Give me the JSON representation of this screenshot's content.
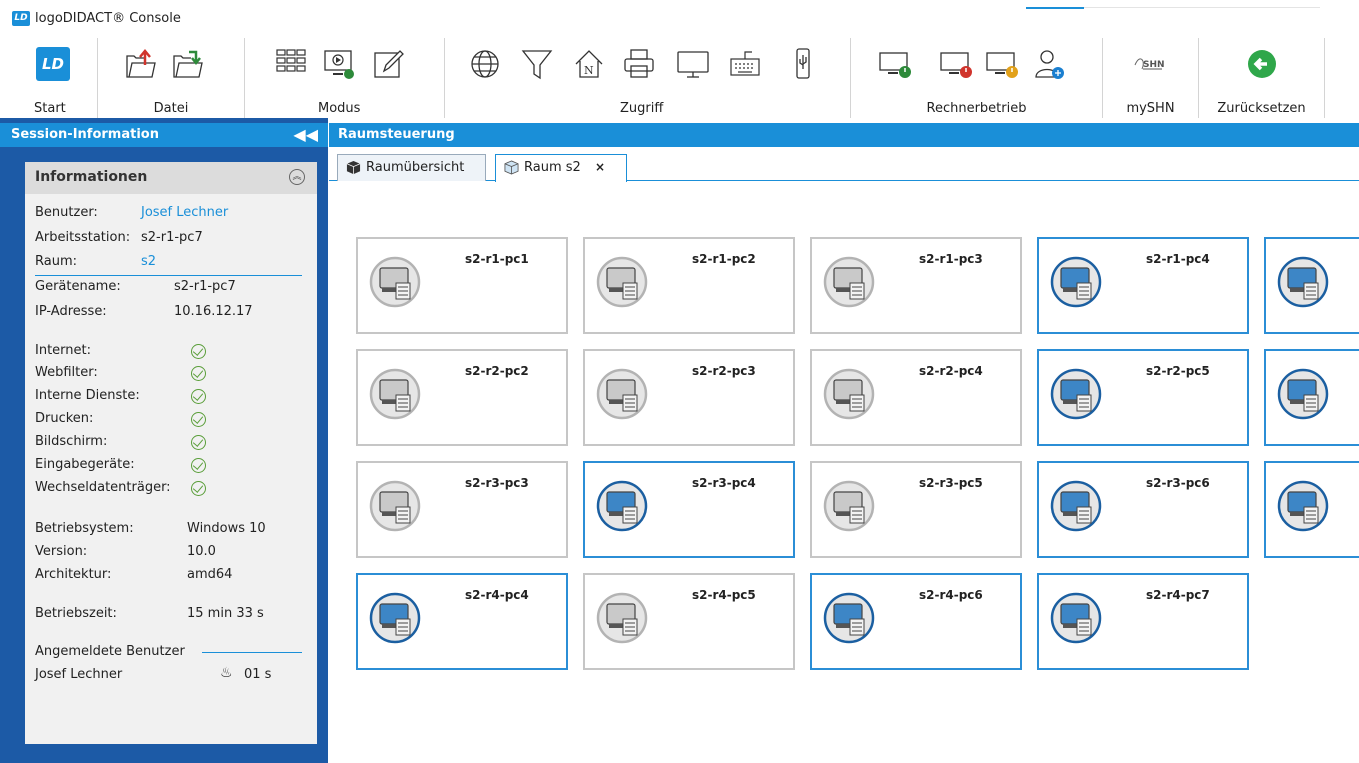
{
  "window": {
    "title": "logoDIDACT® Console",
    "logo_text": "LD"
  },
  "ribbon": {
    "groups": [
      {
        "label": "Start"
      },
      {
        "label": "Datei"
      },
      {
        "label": "Modus"
      },
      {
        "label": "Zugriff"
      },
      {
        "label": "Rechnerbetrieb"
      },
      {
        "label": "mySHN"
      },
      {
        "label": "Zurücksetzen"
      }
    ],
    "start_logo": "LD",
    "shn_text": "SHN"
  },
  "sidebar": {
    "header": "Session-Information",
    "collapse_glyph": "◀◀",
    "info": {
      "title": "Informationen",
      "user_label": "Benutzer:",
      "user_value": "Josef Lechner",
      "ws_label": "Arbeitsstation:",
      "ws_value": "s2-r1-pc7",
      "room_label": "Raum:",
      "room_value": "s2",
      "device_label": "Gerätename:",
      "device_value": "s2-r1-pc7",
      "ip_label": "IP-Adresse:",
      "ip_value": "10.16.12.17",
      "services": [
        "Internet:",
        "Webfilter:",
        "Interne Dienste:",
        "Drucken:",
        "Bildschirm:",
        "Eingabegeräte:",
        "Wechseldatenträger:"
      ],
      "os_label": "Betriebsystem:",
      "os_value": "Windows 10",
      "ver_label": "Version:",
      "ver_value": "10.0",
      "arch_label": "Architektur:",
      "arch_value": "amd64",
      "uptime_label": "Betriebszeit:",
      "uptime_value": "15 min 33 s",
      "logged_label": "Angemeldete Benutzer",
      "logged_user": "Josef Lechner",
      "logged_idle": "01 s"
    }
  },
  "main": {
    "header": "Raumsteuerung",
    "tabs": [
      {
        "label": "Raumübersicht"
      },
      {
        "label": "Raum s2",
        "close": "×"
      }
    ],
    "computers": [
      {
        "name": "s2-r1-pc1",
        "online": false
      },
      {
        "name": "s2-r1-pc2",
        "online": false
      },
      {
        "name": "s2-r1-pc3",
        "online": false
      },
      {
        "name": "s2-r1-pc4",
        "online": true
      },
      {
        "name": "",
        "online": true
      },
      {
        "name": "s2-r2-pc2",
        "online": false
      },
      {
        "name": "s2-r2-pc3",
        "online": false
      },
      {
        "name": "s2-r2-pc4",
        "online": false
      },
      {
        "name": "s2-r2-pc5",
        "online": true
      },
      {
        "name": "",
        "online": true
      },
      {
        "name": "s2-r3-pc3",
        "online": false
      },
      {
        "name": "s2-r3-pc4",
        "online": true
      },
      {
        "name": "s2-r3-pc5",
        "online": false
      },
      {
        "name": "s2-r3-pc6",
        "online": true
      },
      {
        "name": "",
        "online": true
      },
      {
        "name": "s2-r4-pc4",
        "online": true
      },
      {
        "name": "s2-r4-pc5",
        "online": false
      },
      {
        "name": "s2-r4-pc6",
        "online": true
      },
      {
        "name": "s2-r4-pc7",
        "online": true
      }
    ]
  },
  "colors": {
    "accent": "#1a8fd8",
    "sidebar": "#1c5aa6",
    "online_border": "#2b8ed6",
    "offline_border": "#c6c6c6",
    "ok": "#5a9e3a"
  }
}
